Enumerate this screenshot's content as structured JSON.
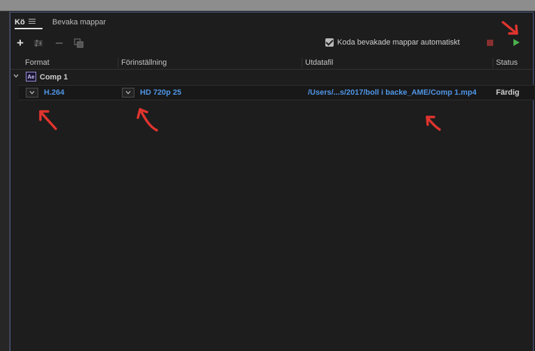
{
  "tabs": {
    "queue": "Kö",
    "watch_folders": "Bevaka mappar"
  },
  "toolbar": {
    "auto_encode_label": "Koda bevakade mappar automatiskt",
    "auto_encode_checked": true
  },
  "columns": [
    "Format",
    "Förinställning",
    "Utdatafil",
    "Status"
  ],
  "queue": {
    "group": {
      "badge": "Ae",
      "title": "Comp 1"
    },
    "items": [
      {
        "format": "H.264",
        "preset": "HD 720p 25",
        "output": "/Users/...s/2017/boll i backe_AME/Comp 1.mp4",
        "status": "Färdig"
      }
    ]
  },
  "icons": [
    "menu-icon",
    "add-icon",
    "settings-icon",
    "remove-icon",
    "duplicate-icon",
    "chevron-down-icon",
    "stop-icon",
    "play-icon"
  ],
  "colors": {
    "link_blue": "#4f95e6",
    "play_green": "#4caf4c",
    "stop_red": "#8a2f2f",
    "annotation_red": "#e0342e",
    "panel_border": "#4a5a8a"
  }
}
